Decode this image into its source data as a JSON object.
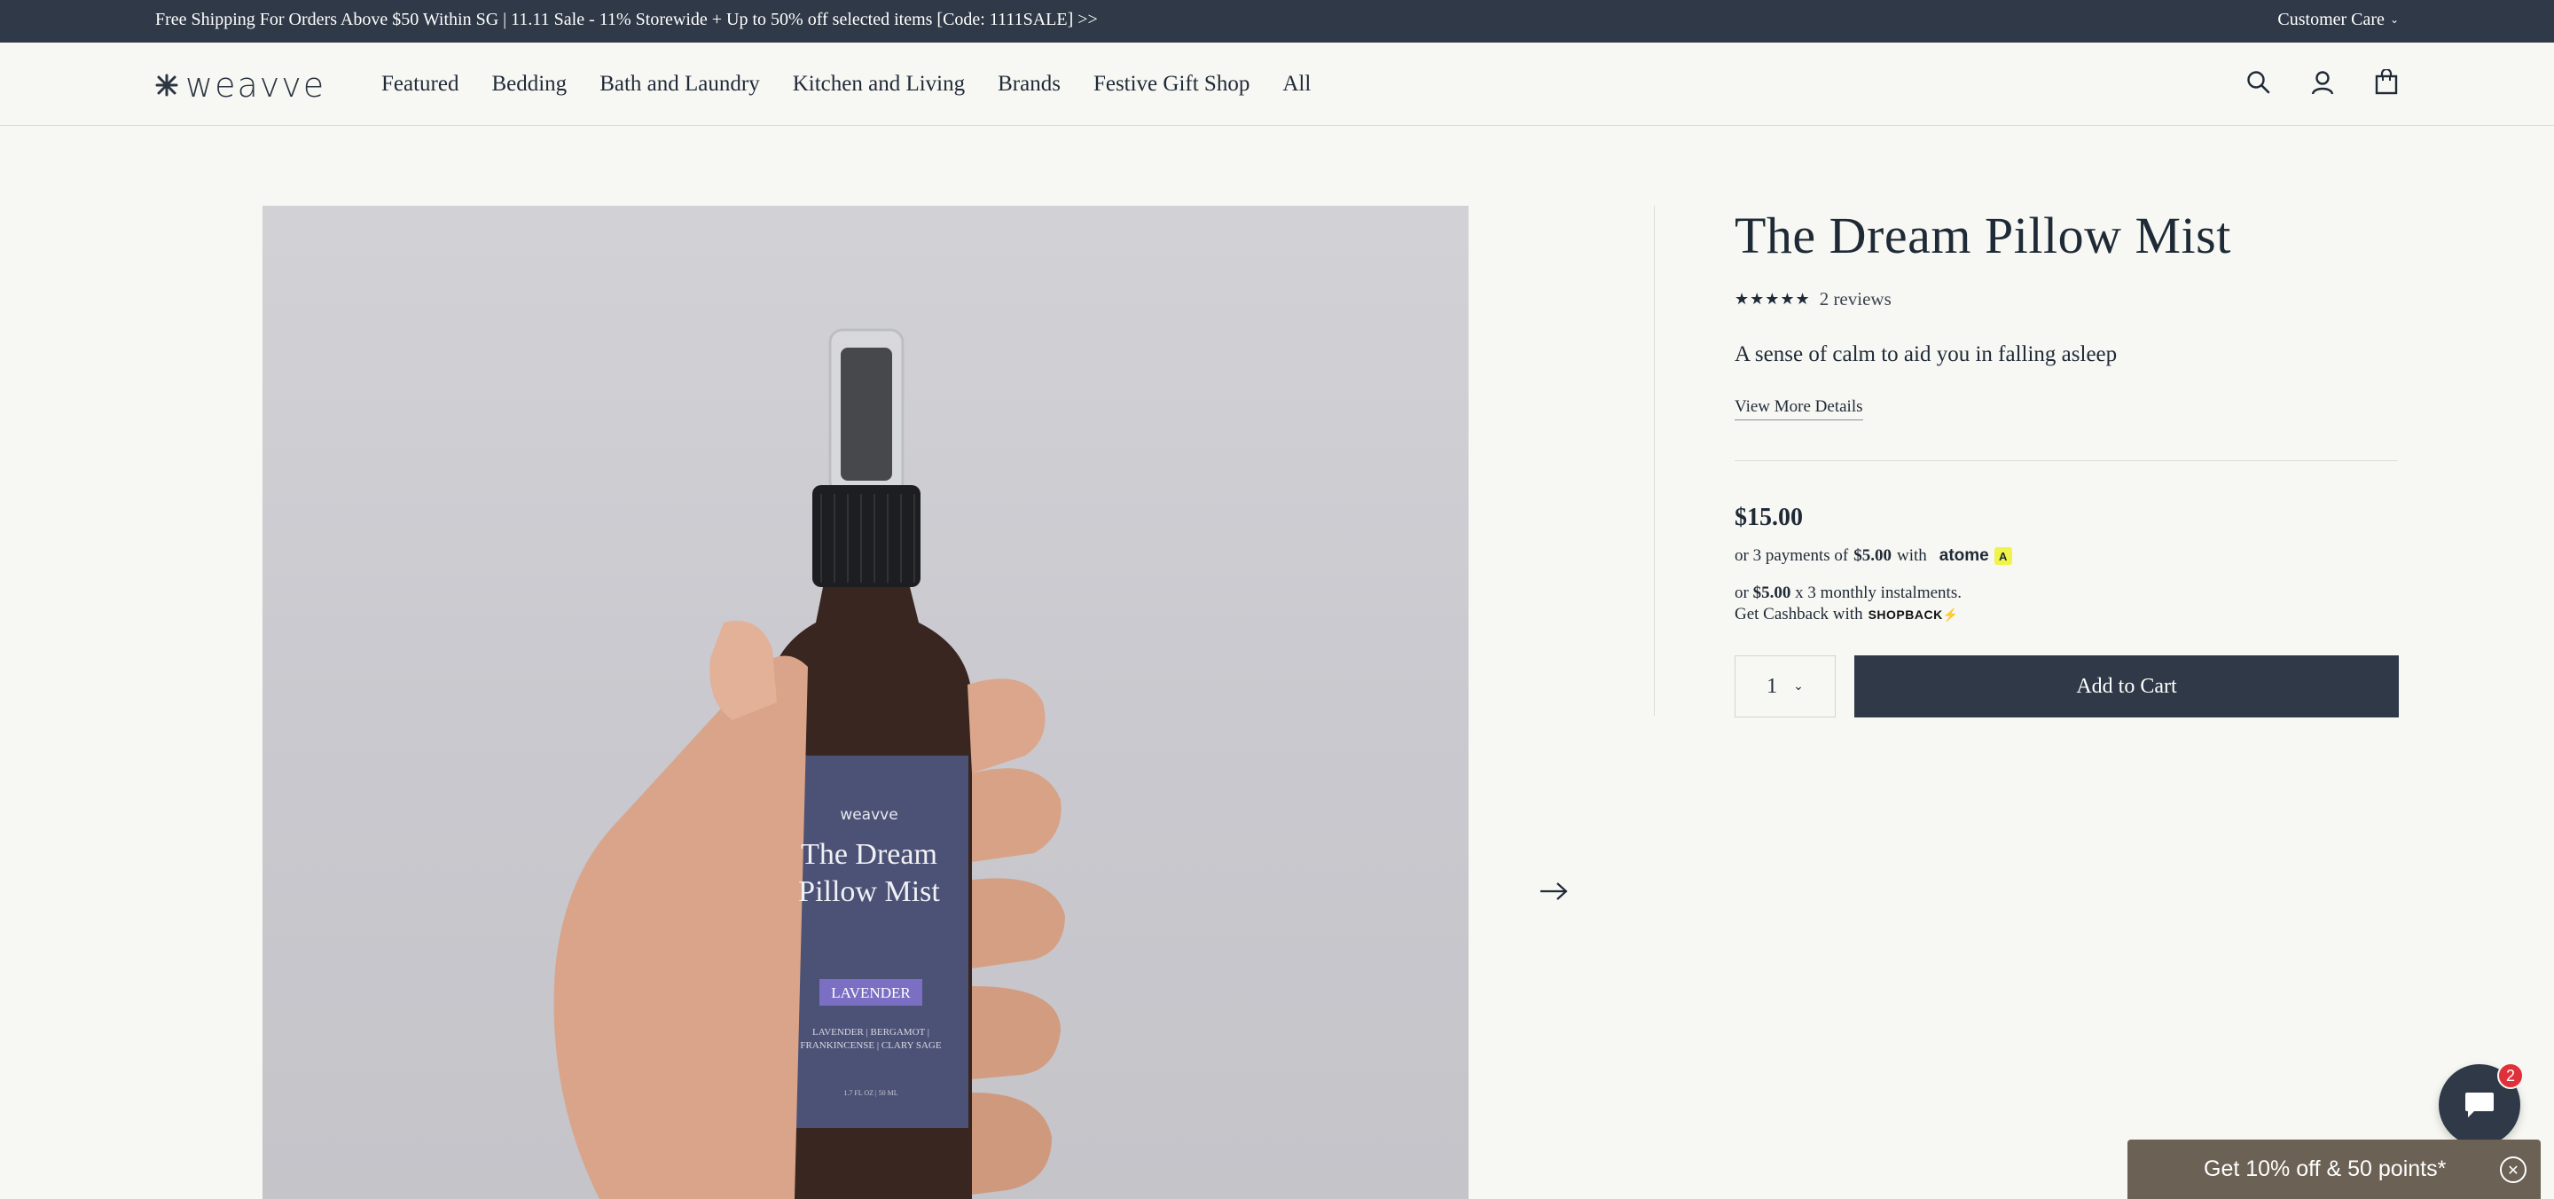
{
  "announcement": {
    "message": "Free Shipping For Orders Above $50 Within SG | 11.11 Sale - 11% Storewide + Up to 50% off selected items [Code: 1111SALE] >>",
    "customer_care": "Customer Care"
  },
  "header": {
    "logo_text": "weavve",
    "nav": [
      "Featured",
      "Bedding",
      "Bath and Laundry",
      "Kitchen and Living",
      "Brands",
      "Festive Gift Shop",
      "All"
    ],
    "icons": [
      "search-icon",
      "account-icon",
      "cart-icon"
    ]
  },
  "gallery": {
    "label_brand": "weavve",
    "label_title_line1": "The Dream",
    "label_title_line2": "Pillow Mist",
    "label_variant": "LAVENDER",
    "label_notes_line1": "LAVENDER | BERGAMOT |",
    "label_notes_line2": "FRANKINCENSE | CLARY SAGE",
    "label_size": "1.7 FL OZ | 50 ML"
  },
  "product": {
    "title": "The Dream Pillow Mist",
    "stars": "★★★★★",
    "rating": 5,
    "reviews": "2 reviews",
    "subtitle": "A sense of calm to aid you in falling asleep",
    "more_details": "View More Details",
    "price": "$15.00",
    "atome_prefix": "or 3 payments of",
    "atome_amount": "$5.00",
    "atome_with": "with",
    "atome_brand": "atome",
    "shopback_line1_prefix": "or",
    "shopback_amount": "$5.00",
    "shopback_line1_suffix": "x 3 monthly instalments.",
    "shopback_line2": "Get Cashback with",
    "shopback_brand": "SHOPBACK",
    "quantity": "1",
    "add_to_cart": "Add to Cart"
  },
  "chat": {
    "unread": "2"
  },
  "promo": {
    "text": "Get 10% off & 50 points*"
  },
  "colors": {
    "navy": "#2f3947",
    "background": "#f7f7f3",
    "promo": "#6b6154",
    "badge": "#e0313b"
  }
}
